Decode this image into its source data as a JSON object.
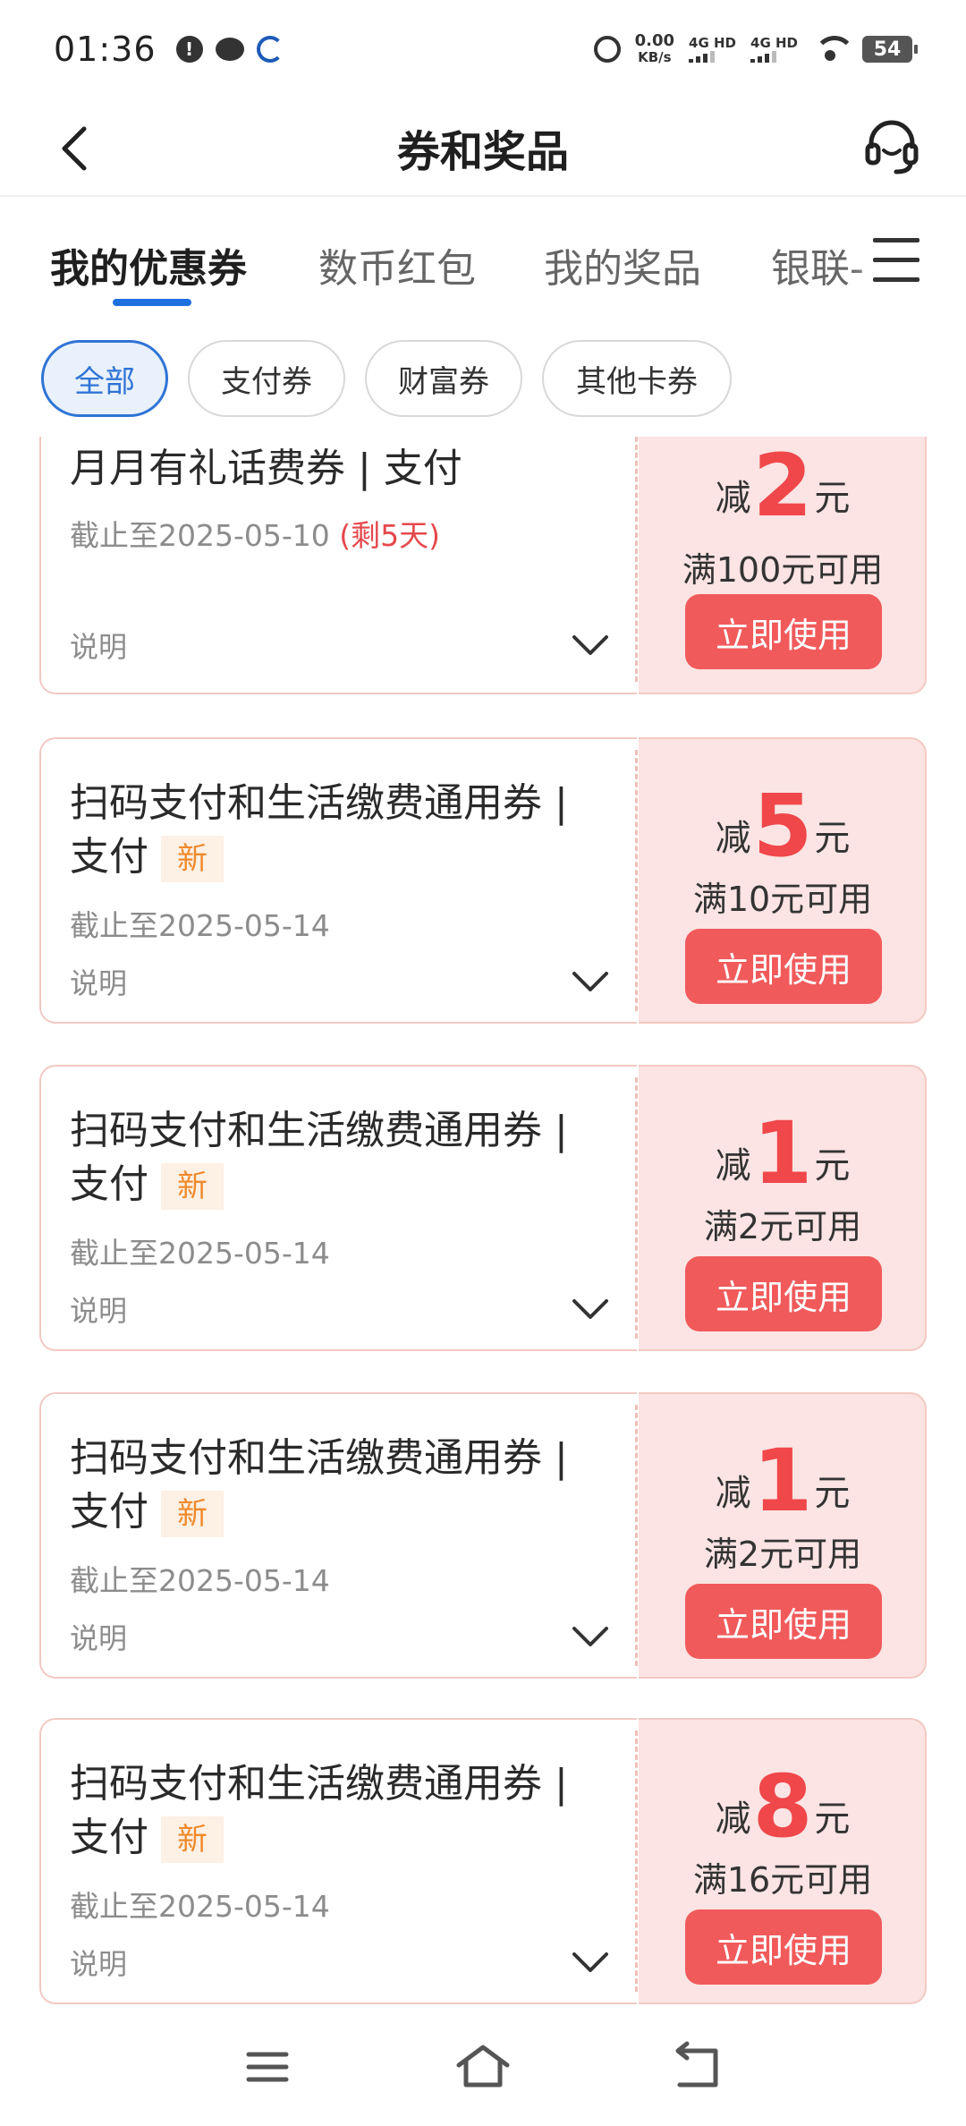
{
  "status_bar": {
    "time": "01:36",
    "speed_value": "0.00",
    "speed_unit": "KB/s",
    "network1": "4G HD",
    "network2": "4G HD",
    "battery": "54"
  },
  "header": {
    "title": "券和奖品"
  },
  "tabs": [
    {
      "label": "我的优惠券",
      "active": true
    },
    {
      "label": "数币红包",
      "active": false
    },
    {
      "label": "我的奖品",
      "active": false
    },
    {
      "label": "银联-",
      "active": false
    }
  ],
  "filters": [
    {
      "label": "全部",
      "active": true
    },
    {
      "label": "支付券",
      "active": false
    },
    {
      "label": "财富券",
      "active": false
    },
    {
      "label": "其他卡券",
      "active": false
    }
  ],
  "coupons": [
    {
      "title": "月月有礼话费券 | 支付",
      "new_badge": "",
      "deadline": "截止至2025-05-10",
      "remaining": "(剩5天)",
      "desc": "说明",
      "minus_label": "减",
      "amount": "2",
      "currency": "元",
      "condition": "满100元可用",
      "button": "立即使用"
    },
    {
      "title": "扫码支付和生活缴费通用券 | 支付",
      "new_badge": "新",
      "deadline": "截止至2025-05-14",
      "remaining": "",
      "desc": "说明",
      "minus_label": "减",
      "amount": "5",
      "currency": "元",
      "condition": "满10元可用",
      "button": "立即使用"
    },
    {
      "title": "扫码支付和生活缴费通用券 | 支付",
      "new_badge": "新",
      "deadline": "截止至2025-05-14",
      "remaining": "",
      "desc": "说明",
      "minus_label": "减",
      "amount": "1",
      "currency": "元",
      "condition": "满2元可用",
      "button": "立即使用"
    },
    {
      "title": "扫码支付和生活缴费通用券 | 支付",
      "new_badge": "新",
      "deadline": "截止至2025-05-14",
      "remaining": "",
      "desc": "说明",
      "minus_label": "减",
      "amount": "1",
      "currency": "元",
      "condition": "满2元可用",
      "button": "立即使用"
    },
    {
      "title": "扫码支付和生活缴费通用券 | 支付",
      "new_badge": "新",
      "deadline": "截止至2025-05-14",
      "remaining": "",
      "desc": "说明",
      "minus_label": "减",
      "amount": "8",
      "currency": "元",
      "condition": "满16元可用",
      "button": "立即使用"
    }
  ],
  "colors": {
    "accent_blue": "#1e6fe0",
    "coupon_red": "#f0474a",
    "button_red": "#f15a5b",
    "coupon_bg": "#fbe4e3",
    "new_badge": "#ef8a2c"
  },
  "icons": {
    "back": "back-arrow-icon",
    "service": "headset-icon",
    "tab_menu": "menu-icon",
    "expand": "chevron-down-icon",
    "nav_menu": "menu-icon",
    "nav_home": "home-icon",
    "nav_back": "return-icon"
  }
}
